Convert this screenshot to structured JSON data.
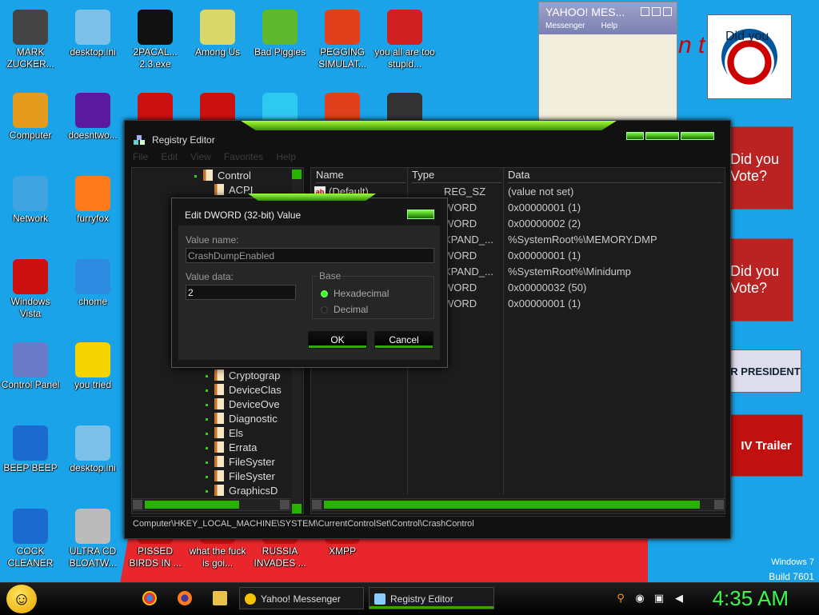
{
  "desktop_icons": [
    {
      "label": "MARK ZUCKER...",
      "icon": "zuckerberg-icon",
      "color": "#444444"
    },
    {
      "label": "desktop.ini",
      "icon": "ini-file-icon",
      "color": "#7cc0e8"
    },
    {
      "label": "2PACAL... 2.3.exe",
      "icon": "cmd-exe-icon",
      "color": "#111111"
    },
    {
      "label": "Among Us",
      "icon": "among-us-icon",
      "color": "#d8d86a"
    },
    {
      "label": "Bad Piggies",
      "icon": "bad-piggies-icon",
      "color": "#5fb82f"
    },
    {
      "label": "PEGGING SIMULAT...",
      "icon": "pegging-sim-icon",
      "color": "#e0401c"
    },
    {
      "label": "you all are too stupid...",
      "icon": "dev-cpp-icon",
      "color": "#d02020"
    },
    {
      "label": "Computer",
      "icon": "computer-icon",
      "color": "#e49a1d"
    },
    {
      "label": "doesntwo...",
      "icon": "yahoo-icon",
      "color": "#5a1aa0"
    },
    {
      "label": "Network",
      "icon": "network-icon",
      "color": "#3fa4e0"
    },
    {
      "label": "furryfox",
      "icon": "firefox-icon",
      "color": "#ff7a1a"
    },
    {
      "label": "Windows Vista",
      "icon": "recycle-bin-icon",
      "color": "#cc1010"
    },
    {
      "label": "chome",
      "icon": "chrome-icon",
      "color": "#2c8ae0"
    },
    {
      "label": "Control Panel",
      "icon": "control-panel-icon",
      "color": "#6a7ac8"
    },
    {
      "label": "you tried",
      "icon": "star-icon",
      "color": "#f5d400"
    },
    {
      "label": "BEEP BEEP",
      "icon": "file-icon",
      "color": "#1a6ad0"
    },
    {
      "label": "desktop.ini",
      "icon": "ini-file-icon",
      "color": "#7cc0e8"
    },
    {
      "label": "COCK CLEANER",
      "icon": "file-icon",
      "color": "#1a6ad0"
    },
    {
      "label": "ULTRA CD BLOATW...",
      "icon": "cd-icon",
      "color": "#bbbbbb"
    },
    {
      "label": "PISSED BIRDS IN ...",
      "icon": "angry-birds-icon",
      "color": "#cc1010"
    },
    {
      "label": "what the fuck is goi...",
      "icon": "unknown-icon",
      "color": "#cc1010"
    },
    {
      "label": "RUSSIA INVADES ...",
      "icon": "unknown-icon",
      "color": "#cc1010"
    },
    {
      "label": "XMPP",
      "icon": "xmpp-icon",
      "color": "#cc1010"
    }
  ],
  "desktop_icons_unlabeled": [
    "angry-birds-icon",
    "angry-birds-icon",
    "gem-icon",
    "pegging-sim-icon",
    "sd-icon"
  ],
  "yahoo_window": {
    "title": "YAHOO! MES...",
    "menu": [
      "Messenger",
      "Help"
    ]
  },
  "posters": {
    "p1": "Did you",
    "p2": "Did you Vote?",
    "p3": "Did you Vote?",
    "p4": "R PRESIDENT",
    "p5": "IV Trailer"
  },
  "windows_mark": {
    "line1": "Windows 7",
    "line2": "Build 7601"
  },
  "regedit": {
    "title": "Registry Editor",
    "menu": [
      "File",
      "Edit",
      "View",
      "Favorites",
      "Help"
    ],
    "tree": [
      {
        "label": "Control",
        "indent": 0,
        "dot": true
      },
      {
        "label": "ACPI",
        "indent": 1,
        "dot": false
      },
      {
        "label": "Cryptograp",
        "indent": 1,
        "dot": true
      },
      {
        "label": "DeviceClas",
        "indent": 1,
        "dot": true
      },
      {
        "label": "DeviceOve",
        "indent": 1,
        "dot": true
      },
      {
        "label": "Diagnostic",
        "indent": 1,
        "dot": true
      },
      {
        "label": "Els",
        "indent": 1,
        "dot": true
      },
      {
        "label": "Errata",
        "indent": 1,
        "dot": true
      },
      {
        "label": "FileSyster",
        "indent": 1,
        "dot": true
      },
      {
        "label": "FileSyster",
        "indent": 1,
        "dot": true
      },
      {
        "label": "GraphicsD",
        "indent": 1,
        "dot": true
      }
    ],
    "columns": [
      "Name",
      "Type",
      "Data"
    ],
    "rows": [
      {
        "name": "(Default)",
        "type": "REG_SZ",
        "data": "(value not set)"
      },
      {
        "name": "",
        "type": "WORD",
        "data": "0x00000001 (1)"
      },
      {
        "name": "",
        "type": "WORD",
        "data": "0x00000002 (2)"
      },
      {
        "name": "",
        "type": "XPAND_...",
        "data": "%SystemRoot%\\MEMORY.DMP"
      },
      {
        "name": "",
        "type": "WORD",
        "data": "0x00000001 (1)"
      },
      {
        "name": "",
        "type": "XPAND_...",
        "data": "%SystemRoot%\\Minidump"
      },
      {
        "name": "",
        "type": "WORD",
        "data": "0x00000032 (50)"
      },
      {
        "name": "",
        "type": "WORD",
        "data": "0x00000001 (1)"
      }
    ],
    "status": "Computer\\HKEY_LOCAL_MACHINE\\SYSTEM\\CurrentControlSet\\Control\\CrashControl"
  },
  "dword_dialog": {
    "title": "Edit DWORD (32-bit) Value",
    "value_name_label": "Value name:",
    "value_name": "CrashDumpEnabled",
    "value_data_label": "Value data:",
    "value_data": "2",
    "base_label": "Base",
    "hex_label": "Hexadecimal",
    "dec_label": "Decimal",
    "ok_label": "OK",
    "cancel_label": "Cancel"
  },
  "taskbar": {
    "tasks": [
      {
        "label": "Yahoo! Messenger",
        "active": false
      },
      {
        "label": "Registry Editor",
        "active": true
      }
    ],
    "clock": "4:35 AM"
  },
  "colors": {
    "accent": "#2fa800",
    "clock": "#3df84a",
    "desktop": "#1aa3e8"
  }
}
